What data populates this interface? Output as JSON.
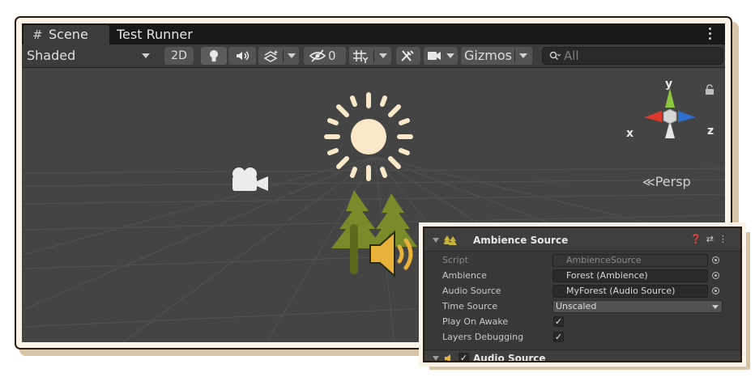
{
  "tabs": [
    {
      "label": "Scene"
    },
    {
      "label": "Test Runner"
    }
  ],
  "toolbar": {
    "shading_mode": "Shaded",
    "mode_2d": "2D",
    "hidden_count": "0",
    "gizmos_label": "Gizmos",
    "search_placeholder": "All"
  },
  "scene": {
    "persp_label": "Persp",
    "axes": {
      "x": "x",
      "y": "y",
      "z": "z"
    }
  },
  "inspector": {
    "component_title": "Ambience Source",
    "next_component_title": "Audio Source",
    "fields": [
      {
        "label": "Script",
        "value": "AmbienceSource"
      },
      {
        "label": "Ambience",
        "value": "Forest (Ambience)"
      },
      {
        "label": "Audio Source",
        "value": "MyForest (Audio Source)"
      },
      {
        "label": "Time Source",
        "value": "Unscaled"
      },
      {
        "label": "Play On Awake",
        "checked": true
      },
      {
        "label": "Layers Debugging",
        "checked": true
      }
    ]
  },
  "colors": {
    "accent_green": "#7a8b2a",
    "sun": "#fbe8c9",
    "speaker": "#e8b23a"
  }
}
